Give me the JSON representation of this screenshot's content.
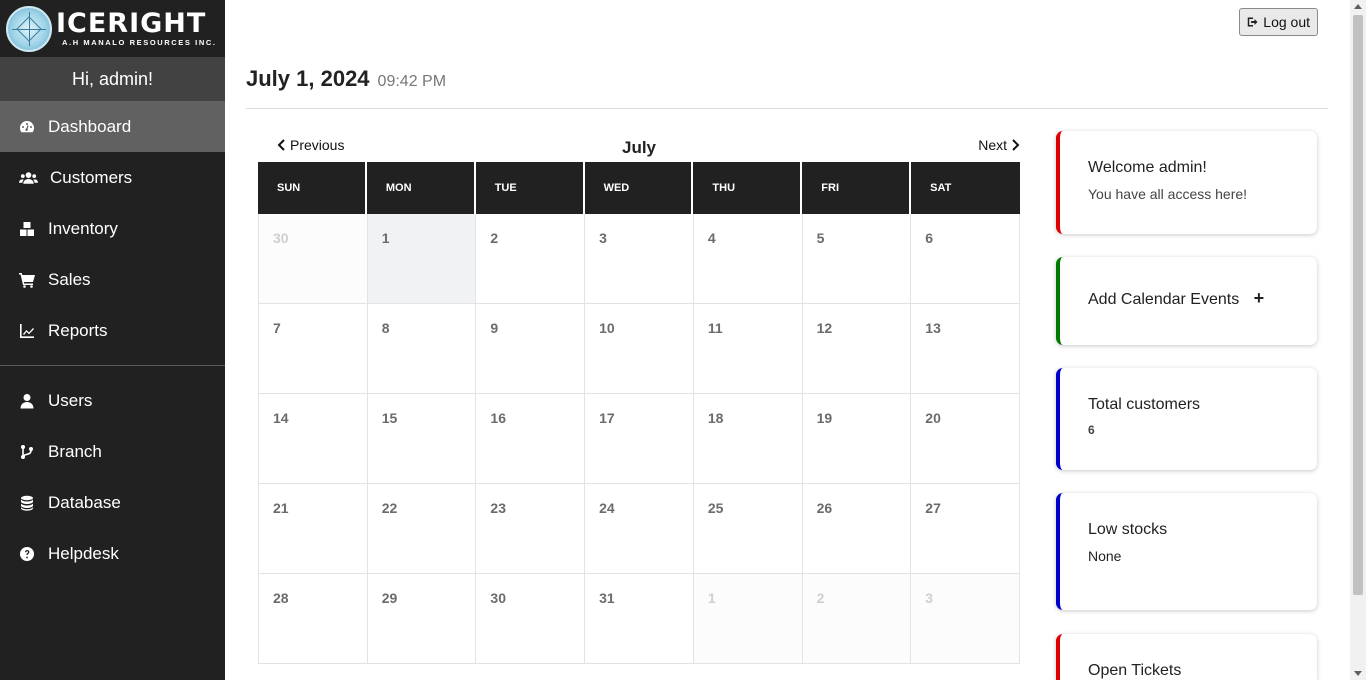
{
  "brand": {
    "title": "ICERIGHT",
    "subtitle": "A.H MANALO RESOURCES INC."
  },
  "sidebar": {
    "greeting": "Hi, admin!",
    "items": [
      {
        "label": "Dashboard",
        "icon": "tachometer-icon",
        "active": true
      },
      {
        "label": "Customers",
        "icon": "users-icon"
      },
      {
        "label": "Inventory",
        "icon": "boxes-icon"
      },
      {
        "label": "Sales",
        "icon": "shopping-cart-icon"
      },
      {
        "label": "Reports",
        "icon": "chart-line-icon"
      }
    ],
    "items2": [
      {
        "label": "Users",
        "icon": "user-icon"
      },
      {
        "label": "Branch",
        "icon": "code-branch-icon"
      },
      {
        "label": "Database",
        "icon": "database-icon"
      },
      {
        "label": "Helpdesk",
        "icon": "question-circle-icon"
      }
    ]
  },
  "header": {
    "logout_label": "Log out",
    "date": "July 1, 2024",
    "time": "09:42 PM"
  },
  "calendar": {
    "prev_label": "Previous",
    "next_label": "Next",
    "month": "July",
    "weekdays": [
      "SUN",
      "MON",
      "TUE",
      "WED",
      "THU",
      "FRI",
      "SAT"
    ],
    "weeks": [
      [
        "30",
        "1",
        "2",
        "3",
        "4",
        "5",
        "6"
      ],
      [
        "7",
        "8",
        "9",
        "10",
        "11",
        "12",
        "13"
      ],
      [
        "14",
        "15",
        "16",
        "17",
        "18",
        "19",
        "20"
      ],
      [
        "21",
        "22",
        "23",
        "24",
        "25",
        "26",
        "27"
      ],
      [
        "28",
        "29",
        "30",
        "31",
        "1",
        "2",
        "3"
      ]
    ],
    "today": "1"
  },
  "cards": {
    "welcome_title": "Welcome admin!",
    "welcome_text": "You have all access here!",
    "add_events": "Add Calendar Events",
    "add_symbol": "+",
    "customers_title": "Total customers",
    "customers_value": "6",
    "stocks_title": "Low stocks",
    "stocks_value": "None",
    "tickets_title": "Open Tickets"
  },
  "colors": {
    "sidebar_bg": "#212121",
    "active_item": "#616161",
    "card_red": "#dd0000",
    "card_green": "#007a00",
    "card_blue": "#0000cc"
  }
}
